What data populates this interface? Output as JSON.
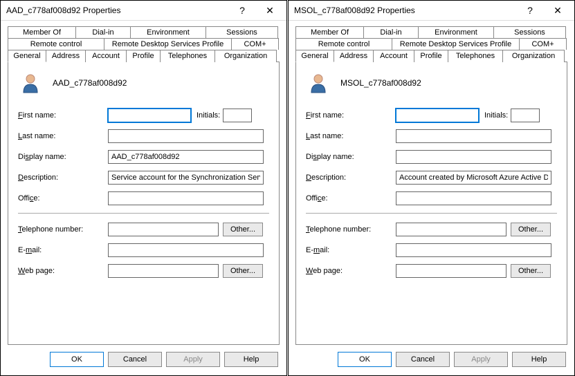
{
  "dialogs": [
    {
      "title": "AAD_c778af008d92 Properties",
      "username": "AAD_c778af008d92",
      "first_name": "",
      "initials": "",
      "last_name": "",
      "display_name": "AAD_c778af008d92",
      "description": "Service account for the Synchronization Service with",
      "office": "",
      "telephone": "",
      "email": "",
      "webpage": ""
    },
    {
      "title": "MSOL_c778af008d92 Properties",
      "username": "MSOL_c778af008d92",
      "first_name": "",
      "initials": "",
      "last_name": "",
      "display_name": "",
      "description": "Account created by Microsoft Azure Active Directory",
      "office": "",
      "telephone": "",
      "email": "",
      "webpage": ""
    }
  ],
  "tabs_row1": [
    "Member Of",
    "Dial-in",
    "Environment",
    "Sessions"
  ],
  "tabs_row2": [
    "Remote control",
    "Remote Desktop Services Profile",
    "COM+"
  ],
  "tabs_row3": [
    "General",
    "Address",
    "Account",
    "Profile",
    "Telephones",
    "Organization"
  ],
  "active_tab": "General",
  "labels": {
    "first_name": "First name:",
    "initials": "Initials:",
    "last_name": "Last name:",
    "display_name": "Display name:",
    "description": "Description:",
    "office": "Office:",
    "telephone": "Telephone number:",
    "email": "E-mail:",
    "webpage": "Web page:",
    "other": "Other..."
  },
  "buttons": {
    "ok": "OK",
    "cancel": "Cancel",
    "apply": "Apply",
    "help": "Help"
  },
  "titlebar": {
    "help": "?",
    "close": "✕"
  }
}
